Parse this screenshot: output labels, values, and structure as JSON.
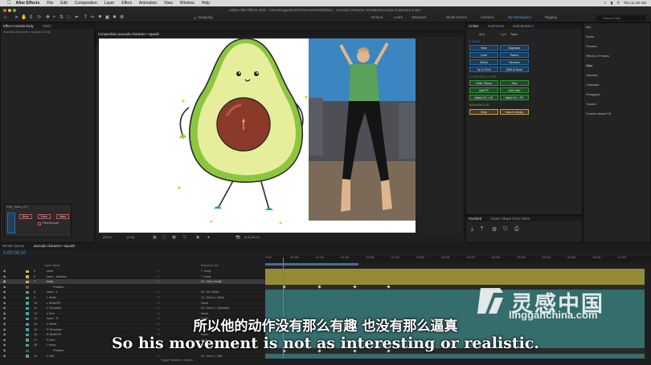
{
  "menubar": {
    "app": "After Effects",
    "items": [
      "File",
      "Edit",
      "Composition",
      "Layer",
      "Effect",
      "Animation",
      "View",
      "Window",
      "Help"
    ],
    "clock": "Thu 11:26 AM"
  },
  "titlebar": {
    "title": "Adobe After Effects 2021 - /Users/meganfrench/Documents/Skillshare - Avocado Character Animation/avocado characters 3.aep *"
  },
  "toolbar": {
    "snapping": "Snapping",
    "workspaces": [
      "Default",
      "Learn",
      "Standard",
      "Small Screen",
      "Libraries",
      "My Workspace",
      "Rigging"
    ],
    "active_workspace": "My Workspace",
    "search_placeholder": "Search Help"
  },
  "left_panel": {
    "tabs": [
      "Effect Controls body",
      "Glitch"
    ],
    "subtitle": "avocado character • squash • body",
    "duik": {
      "title": "Duik_Swiks_v2.0",
      "buttons": [
        "Bone",
        "Ease",
        "Value"
      ],
      "checkbox_label": "Pass through"
    }
  },
  "composition": {
    "tab": "Composition avocado character • squash",
    "breadcrumb": "avocado character • squash",
    "zoom": "(50%)",
    "resolution": "(Full)",
    "timecode": "0;00;00;12"
  },
  "controller": {
    "tabs": [
      "Limber",
      "Keyframes",
      "Duik Bassel.2"
    ],
    "arm_label": "Arm",
    "type_label": "Type",
    "type_value": "Taper",
    "sections": {
      "links": "LINKS",
      "controllers": "CONTROLLERS",
      "advanced": "ADVANCED"
    },
    "link_buttons": [
      "New",
      "Duplicate",
      "Limb",
      "Parent",
      "Select",
      "Rename",
      "Tip & Pivot",
      "Shift to Bone"
    ],
    "controller_buttons": [
      "Hide / Show",
      "Size",
      "Add FK",
      "Add Joint",
      "Match FK > IK",
      "Match IK > FK"
    ],
    "advanced_buttons": [
      "Help",
      "Import Library"
    ]
  },
  "overlord": {
    "tabs": [
      "Overlord",
      "Create Shape From Paths"
    ]
  },
  "right_panel": {
    "items": [
      "Info",
      "Audio",
      "Preview",
      "Effects & Presets",
      "Align",
      "Libraries",
      "Character",
      "Paragraph",
      "Tracker",
      "Content-Aware Fill"
    ]
  },
  "timeline": {
    "tabs": [
      "Render Queue",
      "avocado character • squash"
    ],
    "timecode": "0:00:00:10",
    "columns": [
      "Layer Name",
      "Parent & Link"
    ],
    "ruler": [
      "0:00f",
      "00:15f",
      "01:00f",
      "01:15f",
      "02:00f",
      "02:15f",
      "03:00f",
      "03:15f",
      "04:00f",
      "04:15f",
      "05:00f",
      "05:15f",
      "06:00f",
      "06:15f",
      "07:00f"
    ],
    "layers": [
      {
        "num": "5",
        "name": "seed",
        "parent": "7. body",
        "color": "#c9b24a"
      },
      {
        "num": "6",
        "name": "seed - shadow",
        "parent": "7. body",
        "color": "#c9b24a"
      },
      {
        "num": "7",
        "name": "body",
        "parent": "21. Zero | body",
        "color": "#c9b24a"
      },
      {
        "num": "",
        "name": "Position",
        "parent": "",
        "color": "#555"
      },
      {
        "num": "8",
        "name": "hand - L",
        "parent": "13. Ve | Wrist",
        "color": "#4fa0a0"
      },
      {
        "num": "9",
        "name": "L Wrist",
        "parent": "14. Zero | L Wrist",
        "color": "#4fa0a0"
      },
      {
        "num": "10",
        "name": "L Wrist/FK",
        "parent": "None",
        "color": "#4fa0a0"
      },
      {
        "num": "11",
        "name": "L Shoulder",
        "parent": "21. Zero | L Shoulder",
        "color": "#4fa0a0"
      },
      {
        "num": "12",
        "name": "L Arm",
        "parent": "None",
        "color": "#4fa0a0"
      },
      {
        "num": "13",
        "name": "hand - R",
        "parent": "None",
        "color": "#4fa0a0"
      },
      {
        "num": "14",
        "name": "R Wrist",
        "parent": "None",
        "color": "#4fa0a0"
      },
      {
        "num": "15",
        "name": "R Shoulder",
        "parent": "None",
        "color": "#4fa0a0"
      },
      {
        "num": "16",
        "name": "R Wrist/FK",
        "parent": "None",
        "color": "#4fa0a0"
      },
      {
        "num": "17",
        "name": "R Arm",
        "parent": "None",
        "color": "#4fa0a0"
      },
      {
        "num": "18",
        "name": "L body",
        "parent": "None",
        "color": "#4fa0a0"
      },
      {
        "num": "",
        "name": "Position",
        "parent": "",
        "color": "#555"
      },
      {
        "num": "19",
        "name": "L Hip",
        "parent": "21. Zero | L Hip",
        "color": "#4fa0a0"
      }
    ],
    "footer": "Toggle Switches / Modes"
  },
  "subtitles": {
    "cn": "所以他的动作没有那么有趣 也没有那么逼真",
    "en": "So his movement is not as interesting or realistic."
  },
  "watermark": {
    "cn": "灵感中国",
    "en": "lingganchina.com"
  },
  "colors": {
    "accent": "#2a7ad8",
    "avocado_skin": "#8cc63f",
    "avocado_flesh": "#e6ee9c",
    "pit": "#8b3a2a",
    "shoe": "#1fa6a0"
  }
}
